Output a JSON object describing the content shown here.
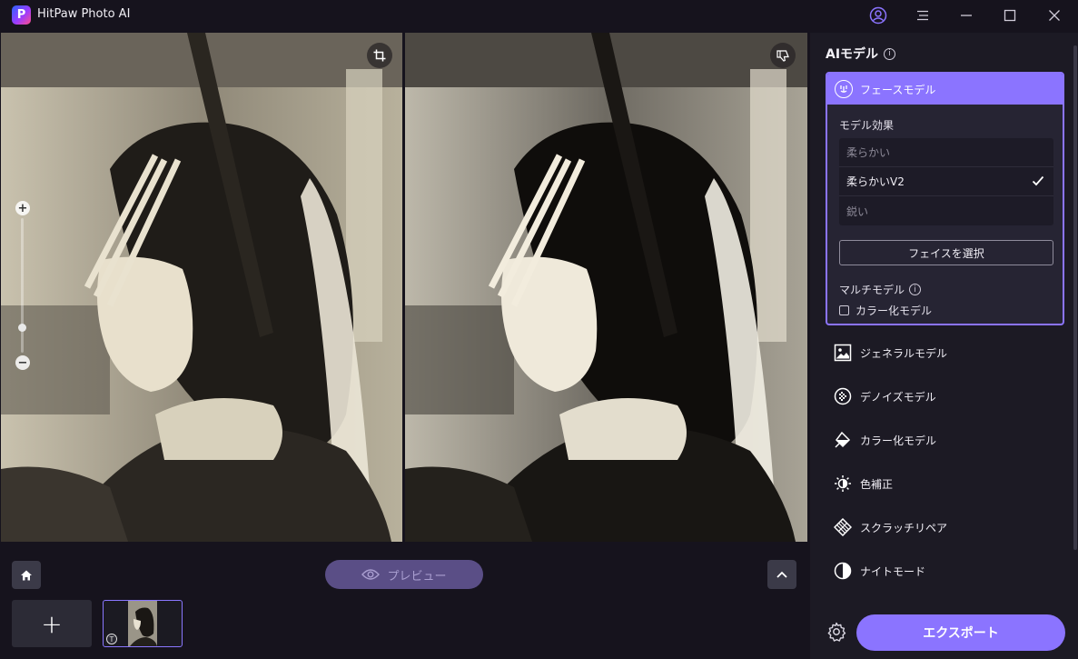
{
  "app": {
    "title": "HitPaw Photo AI",
    "logo_letter": "P"
  },
  "titlebar": {
    "icons": [
      "account-icon",
      "menu-icon",
      "minimize-icon",
      "maximize-icon",
      "close-icon"
    ]
  },
  "canvas": {
    "left_tools": [
      "crop-icon"
    ],
    "right_tools": [
      "thumbs-down-icon"
    ],
    "zoom": {
      "in_label": "+",
      "out_label": "−",
      "level": 0.18
    }
  },
  "bottom": {
    "preview_label": "プレビュー",
    "add_label": "+",
    "thumb_badge": "T"
  },
  "sidebar": {
    "heading": "AIモデル",
    "face_model": {
      "label": "フェースモデル",
      "effect_heading": "モデル効果",
      "effects": [
        {
          "label": "柔らかい",
          "selected": false
        },
        {
          "label": "柔らかいV2",
          "selected": true
        },
        {
          "label": "鋭い",
          "selected": false
        }
      ],
      "select_face_label": "フェイスを選択",
      "multi_model_label": "マルチモデル",
      "colorize_checkbox_label": "カラー化モデル",
      "colorize_checked": false
    },
    "models": [
      {
        "label": "ジェネラルモデル",
        "icon": "image-icon"
      },
      {
        "label": "デノイズモデル",
        "icon": "denoise-icon"
      },
      {
        "label": "カラー化モデル",
        "icon": "paint-bucket-icon"
      },
      {
        "label": "色補正",
        "icon": "sun-icon"
      },
      {
        "label": "スクラッチリペア",
        "icon": "scratch-repair-icon"
      },
      {
        "label": "ナイトモード",
        "icon": "half-circle-icon"
      }
    ],
    "export_label": "エクスポート"
  },
  "colors": {
    "accent": "#8b74ff",
    "background": "#16131d",
    "sidebar": "#1c1a24"
  }
}
